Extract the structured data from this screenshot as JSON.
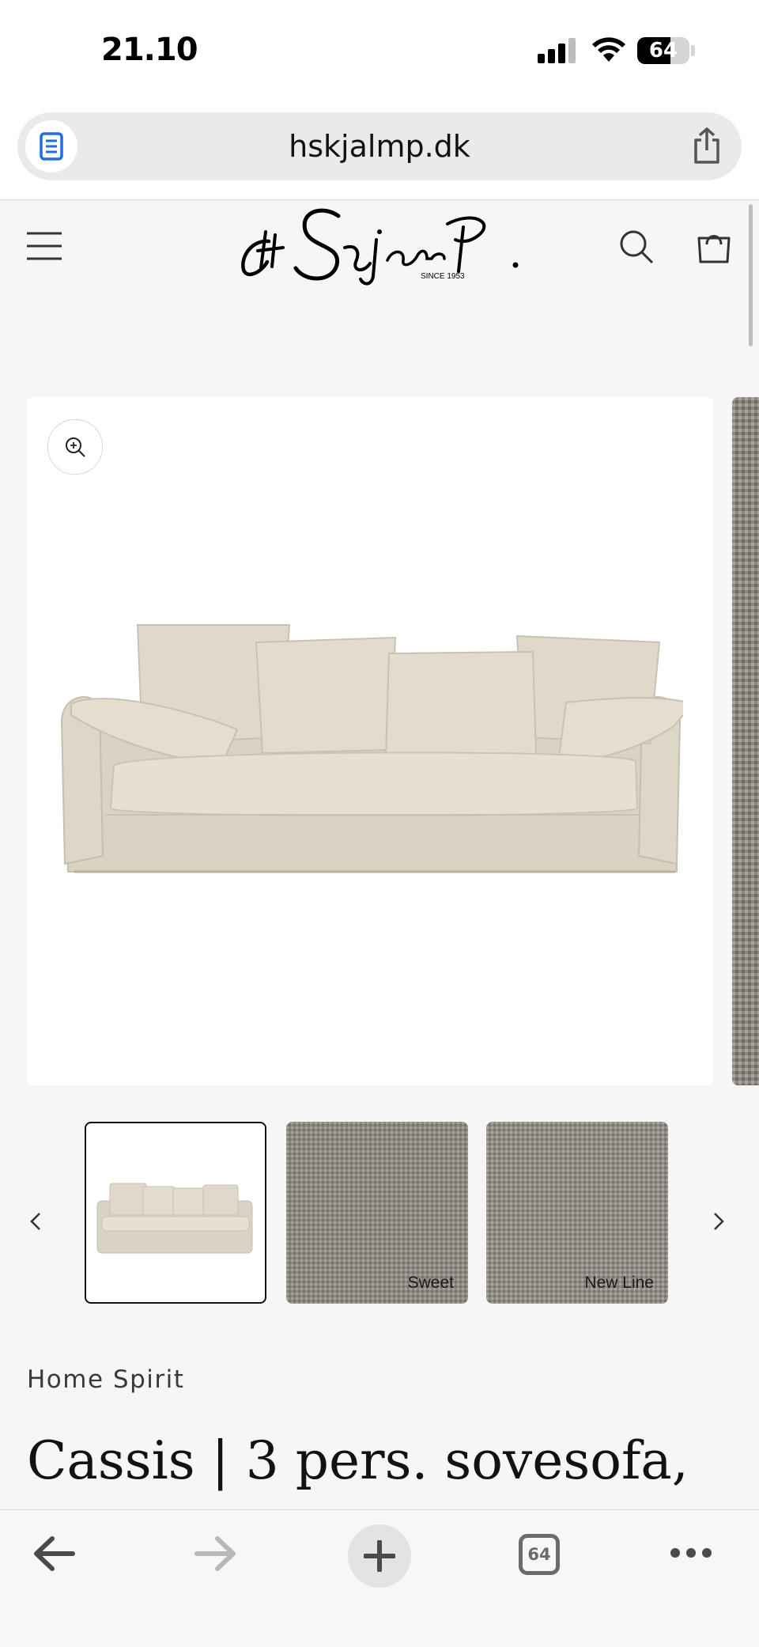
{
  "status_bar": {
    "time": "21.10",
    "battery": "64"
  },
  "browser": {
    "url": "hskjalmp.dk",
    "tab_count": "64"
  },
  "header": {
    "logo_text": "H. Skjalm P.",
    "logo_subtext": "SINCE 1953"
  },
  "gallery": {
    "thumbnails": [
      {
        "label": ""
      },
      {
        "label": "Sweet"
      },
      {
        "label": "New Line"
      }
    ]
  },
  "product": {
    "vendor": "Home Spirit",
    "title": "Cassis | 3 pers. sovesofa,"
  },
  "colors": {
    "background": "#f6f6f6",
    "sofa_linen": "#ddd7c8",
    "text": "#121212"
  }
}
